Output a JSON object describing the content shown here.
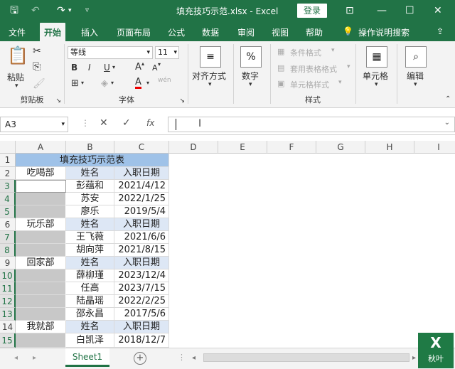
{
  "window": {
    "title": "填充技巧示范.xlsx - Excel",
    "login_label": "登录"
  },
  "menu": {
    "tabs": [
      {
        "label": "文件"
      },
      {
        "label": "开始"
      },
      {
        "label": "插入"
      },
      {
        "label": "页面布局"
      },
      {
        "label": "公式"
      },
      {
        "label": "数据"
      },
      {
        "label": "审阅"
      },
      {
        "label": "视图"
      },
      {
        "label": "帮助"
      }
    ],
    "tell_me": "操作说明搜索"
  },
  "ribbon": {
    "clipboard": {
      "paste": "粘贴",
      "group": "剪贴板"
    },
    "font": {
      "name": "等线",
      "size": "11",
      "group": "字体",
      "bold": "B",
      "italic": "I",
      "underline": "U",
      "grow": "A",
      "shrink": "A",
      "font_color": "A",
      "phonetic": "wén"
    },
    "alignment": {
      "label": "对齐方式"
    },
    "number": {
      "label": "数字",
      "icon": "%"
    },
    "styles": {
      "conditional": "条件格式",
      "table": "套用表格格式",
      "cell": "单元格样式",
      "group": "样式"
    },
    "cells": {
      "label": "单元格"
    },
    "editing": {
      "label": "编辑"
    }
  },
  "formula_bar": {
    "name_box": "A3",
    "fx": "fx",
    "value": ""
  },
  "sheet": {
    "columns": [
      "A",
      "B",
      "C",
      "D",
      "E",
      "F",
      "G",
      "H",
      "I"
    ],
    "rows": [
      "1",
      "2",
      "3",
      "4",
      "5",
      "6",
      "7",
      "8",
      "9",
      "10",
      "11",
      "12",
      "13",
      "14",
      "15"
    ],
    "cells": {
      "r1": "填充技巧示范表",
      "a2": "吃喝部",
      "b2": "姓名",
      "c2": "入职日期",
      "b3": "彭蕴和",
      "c3": "2021/4/12",
      "b4": "苏安",
      "c4": "2022/1/25",
      "b5": "廖乐",
      "c5": "2019/5/4",
      "a6": "玩乐部",
      "b6": "姓名",
      "c6": "入职日期",
      "b7": "王飞薇",
      "c7": "2021/6/6",
      "b8": "胡向萍",
      "c8": "2021/8/15",
      "a9": "回家部",
      "b9": "姓名",
      "c9": "入职日期",
      "b10": "薛柳瑾",
      "c10": "2023/12/4",
      "b11": "任高",
      "c11": "2023/7/15",
      "b12": "陆晶瑶",
      "c12": "2022/2/25",
      "b13": "邵永昌",
      "c13": "2017/5/6",
      "a14": "我就部",
      "b14": "姓名",
      "c14": "入职日期",
      "b15": "白凯泽",
      "c15": "2018/12/7"
    }
  },
  "status": {
    "sheet_tab": "Sheet1",
    "add_sheet": "+",
    "watermark": "秋叶"
  },
  "colors": {
    "accent": "#217346",
    "header_blue": "#dde7f5",
    "title_blue": "#9fc2e8",
    "blank_gray": "#c8c8c8"
  }
}
